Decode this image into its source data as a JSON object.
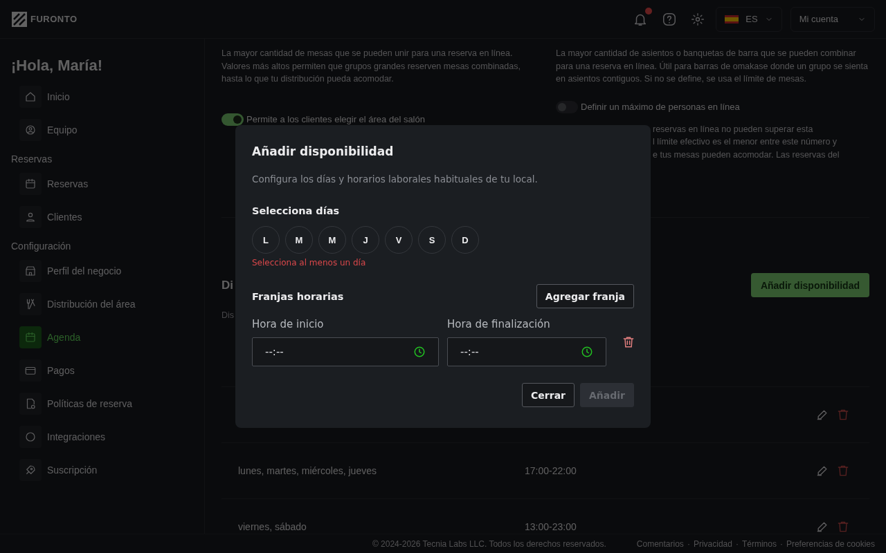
{
  "header": {
    "logo": "FURONTO",
    "notifications_unread": true,
    "language": "ES",
    "account": "Mi cuenta"
  },
  "sidebar": {
    "greeting": "¡Hola, María!",
    "groups": [
      {
        "items": [
          {
            "label": "Inicio",
            "selected": false
          },
          {
            "label": "Equipo",
            "selected": false
          }
        ]
      },
      {
        "title": "Reservas",
        "items": [
          {
            "label": "Reservas",
            "selected": false
          },
          {
            "label": "Clientes",
            "selected": false
          }
        ]
      },
      {
        "title": "Configuración",
        "items": [
          {
            "label": "Perfil del negocio",
            "selected": false
          },
          {
            "label": "Distribución del área",
            "selected": false
          },
          {
            "label": "Agenda",
            "selected": true
          },
          {
            "label": "Pagos",
            "selected": false
          },
          {
            "label": "Políticas de reserva",
            "selected": false
          },
          {
            "label": "Integraciones",
            "selected": false
          },
          {
            "label": "Suscripción",
            "selected": false
          }
        ]
      }
    ]
  },
  "settings": {
    "left": {
      "description": "La mayor cantidad de mesas que se pueden unir para una reserva en línea. Valores más altos permiten que grupos grandes reserven mesas combinadas, hasta lo que tu distribución pueda acomodar.",
      "toggle": {
        "label": "Permite a los clientes elegir el área del salón",
        "on": true
      }
    },
    "right": {
      "description": "La mayor cantidad de asientos o banquetas de barra que se pueden combinar para una reserva en línea. Útil para barras de omakase donde un grupo se sienta en asientos contiguos. Si no se define, se usa el límite de mesas.",
      "toggle": {
        "label": "Definir un máximo de personas en línea",
        "on": false
      },
      "note_lines": [
        "reservas en línea no pueden superar esta",
        "l límite efectivo es el menor entre este número y",
        "e tus mesas pueden acomodar. Las reservas del"
      ]
    }
  },
  "availability": {
    "title": "Di",
    "subtitle": "Dis",
    "add_button": "Añadir disponibilidad",
    "rows": [
      {},
      {
        "days": "lunes, martes, miércoles, jueves",
        "hours": "17:00-22:00"
      },
      {
        "days": "viernes, sábado",
        "hours": "13:00-23:00"
      }
    ]
  },
  "footer": {
    "copyright": "© 2024-2026 Tecnia Labs LLC. Todos los derechos reservados.",
    "links": [
      "Comentarios",
      "Privacidad",
      "Términos",
      "Preferencias de cookies"
    ],
    "separator": "·"
  },
  "modal": {
    "title": "Añadir disponibilidad",
    "description": "Configura los días y horarios laborales habituales de tu local.",
    "days_label": "Selecciona días",
    "days": [
      {
        "label": "L",
        "selected": false
      },
      {
        "label": "M",
        "selected": false
      },
      {
        "label": "M",
        "selected": false
      },
      {
        "label": "J",
        "selected": false
      },
      {
        "label": "V",
        "selected": false
      },
      {
        "label": "S",
        "selected": false
      },
      {
        "label": "D",
        "selected": false
      }
    ],
    "error": "Selecciona al menos un día",
    "slots_label": "Franjas horarias",
    "add_slot": "Agregar franja",
    "slots": [
      {
        "start_label": "Hora de inicio",
        "start_value": "--:--",
        "end_label": "Hora de finalización",
        "end_value": "--:--"
      }
    ],
    "buttons": [
      {
        "label": "Cerrar",
        "kind": "secondary",
        "disabled": false
      },
      {
        "label": "Añadir",
        "kind": "primary",
        "disabled": true
      }
    ]
  }
}
